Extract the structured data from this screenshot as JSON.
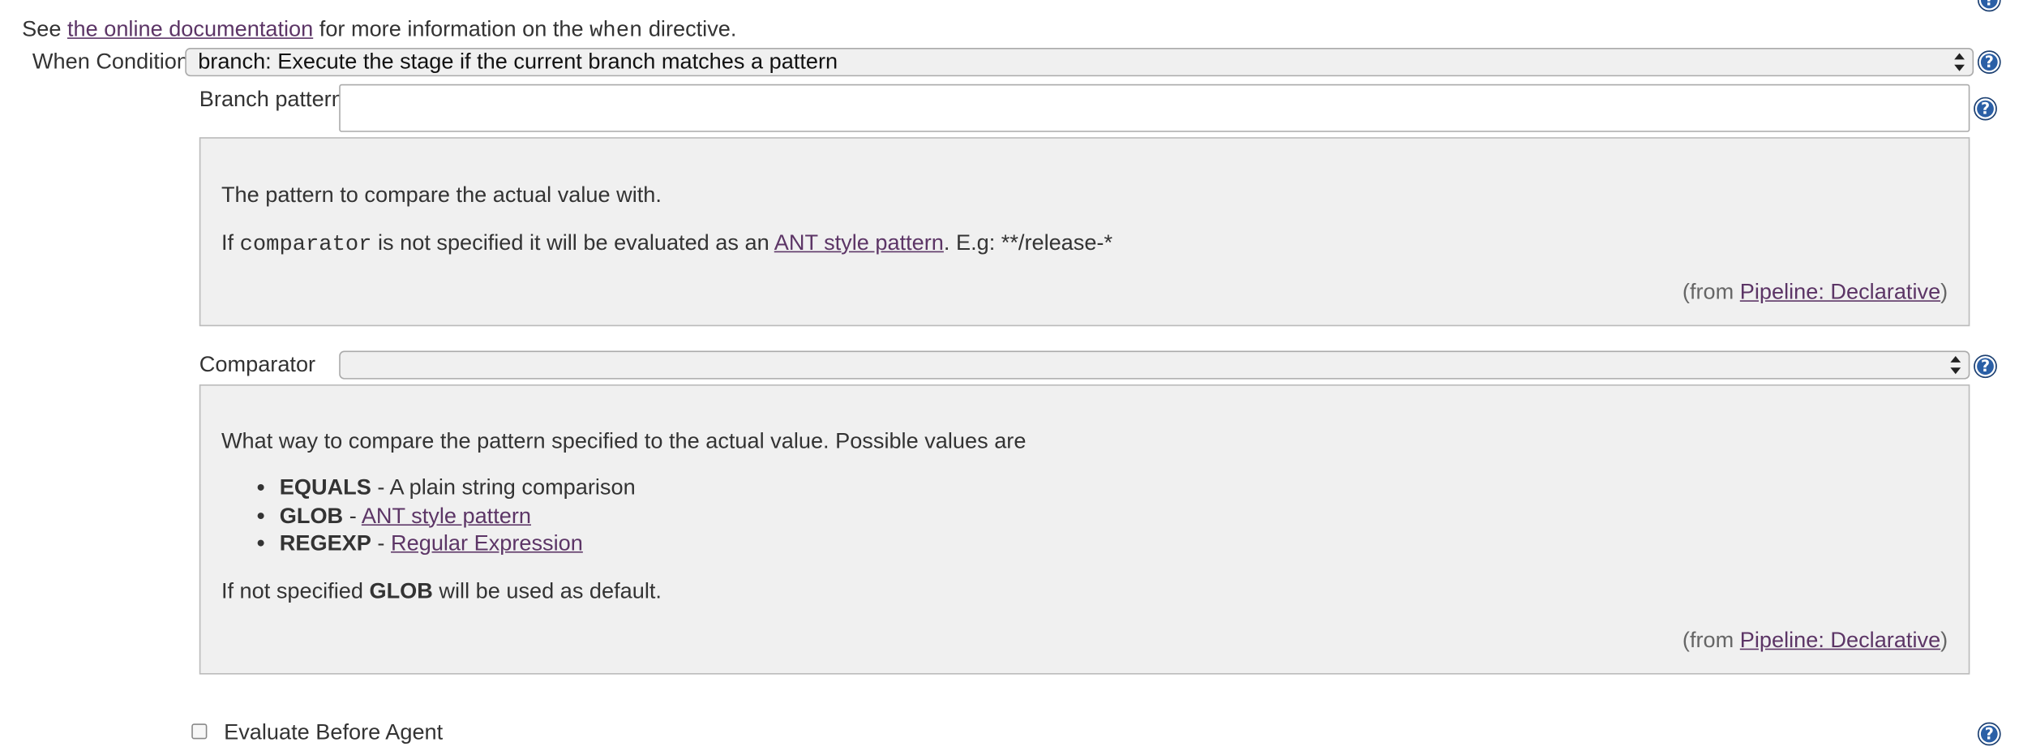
{
  "intro": {
    "prefix": "See",
    "link": "the online documentation",
    "middle": "for more information on the",
    "code": "when",
    "suffix": "directive."
  },
  "when_condition": {
    "label": "When Condition",
    "selected": "branch: Execute the stage if the current branch matches a pattern"
  },
  "branch_pattern": {
    "label": "Branch pattern",
    "value": "",
    "help": {
      "line1": "The pattern to compare the actual value with.",
      "line2_prefix": "If",
      "line2_code": "comparator",
      "line2_middle": "is not specified it will be evaluated as an",
      "line2_link": "ANT style pattern",
      "line2_suffix": ". E.g: **/release-*",
      "from_prefix": "(from",
      "from_link": "Pipeline: Declarative",
      "from_suffix": ")"
    }
  },
  "comparator": {
    "label": "Comparator",
    "selected": "",
    "help": {
      "intro": "What way to compare the pattern specified to the actual value. Possible values are",
      "items": [
        {
          "term": "EQUALS",
          "sep": "-",
          "desc": "A plain string comparison",
          "link": ""
        },
        {
          "term": "GLOB",
          "sep": "-",
          "desc": "",
          "link": "ANT style pattern"
        },
        {
          "term": "REGEXP",
          "sep": "-",
          "desc": "",
          "link": "Regular Expression"
        }
      ],
      "default_prefix": "If not specified",
      "default_term": "GLOB",
      "default_suffix": "will be used as default.",
      "from_prefix": "(from",
      "from_link": "Pipeline: Declarative",
      "from_suffix": ")"
    }
  },
  "evaluate_before_agent": {
    "label": "Evaluate Before Agent",
    "checked": false
  },
  "help_icon_glyph": "?",
  "icons": {
    "help": "help-icon",
    "dropdown": "select-arrows-icon",
    "checkbox": "checkbox-icon"
  },
  "colors": {
    "link": "#5c3566",
    "help_icon": "#2a5fa6",
    "help_area_bg": "#f0f0f0"
  }
}
